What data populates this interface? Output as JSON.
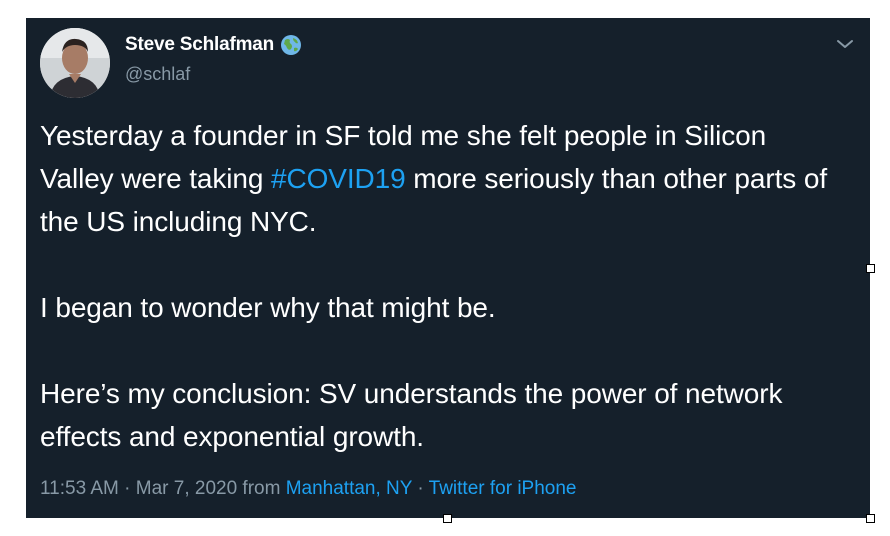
{
  "tweet": {
    "author_name": "Steve Schlafman",
    "author_handle": "@schlaf",
    "badge_icon": "globe-icon",
    "menu_icon": "chevron-down-icon",
    "paragraphs": [
      {
        "before": "Yesterday a founder in SF told me she felt people in Silicon Valley were taking ",
        "hashtag": "#COVID19",
        "after": " more seriously than other parts of the US including NYC."
      },
      {
        "text": "I began to wonder why that might be."
      },
      {
        "text": "Here’s my conclusion: SV understands the power of network effects and exponential growth."
      }
    ],
    "time": "11:53 AM · Mar 7, 2020 from ",
    "location": "Manhattan, NY",
    "separator": " · ",
    "source": "Twitter for iPhone"
  },
  "colors": {
    "background": "#15202b",
    "link": "#1da1f2",
    "secondary_text": "#8899a6"
  }
}
